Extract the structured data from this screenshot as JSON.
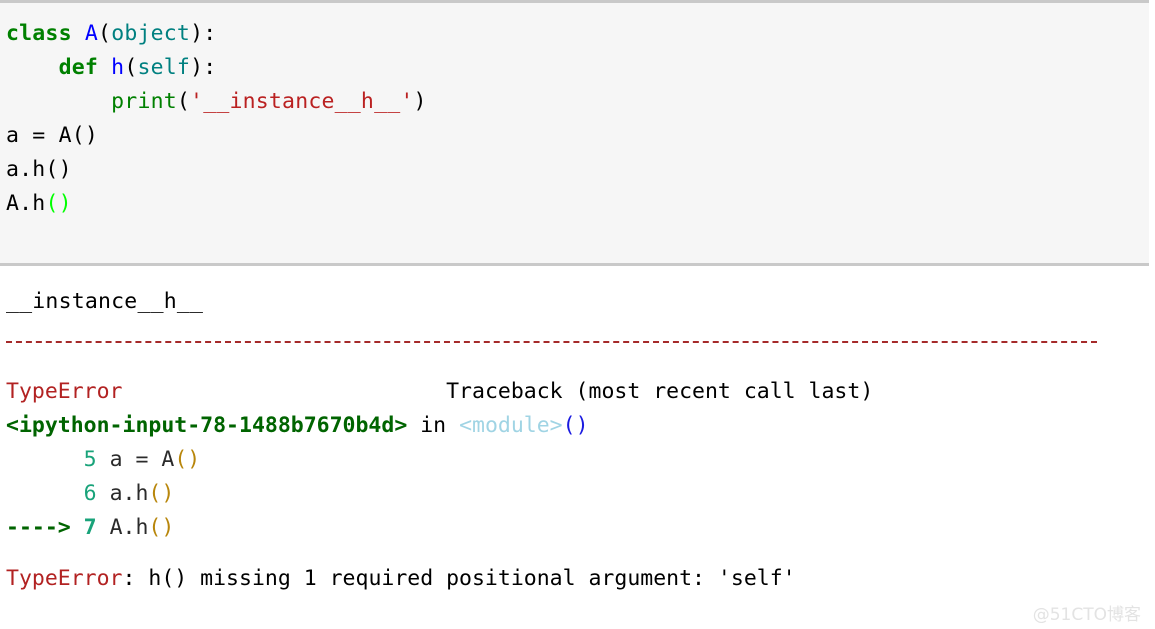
{
  "cell": {
    "background_color": "#f6f6f6",
    "border_color": "#c9c9c9",
    "lines": [
      {
        "id": "l1",
        "kw": "class",
        "sp1": " ",
        "cls": "A",
        "p1": "(",
        "base": "object",
        "p2": "):"
      },
      {
        "id": "l2",
        "indent": "    ",
        "kw": "def",
        "sp1": " ",
        "fn": "h",
        "p1": "(",
        "base": "self",
        "p2": "):"
      },
      {
        "id": "l3",
        "indent": "        ",
        "builtin": "print",
        "p1": "(",
        "str": "'__instance__h__'",
        "p2": ")"
      },
      {
        "id": "l4",
        "text": ""
      },
      {
        "id": "l5",
        "text": "a = A()"
      },
      {
        "id": "l6",
        "text": "a.h()"
      },
      {
        "id": "l7",
        "prefix": "A.h",
        "highlight_paren": "()"
      }
    ]
  },
  "output": {
    "stdout": "__instance__h__",
    "separator": {
      "color": "#a52a2a",
      "style": "dashed"
    },
    "traceback": {
      "error_type": "TypeError",
      "header_right": "Traceback (most recent call last)",
      "location": "<ipython-input-78-1488b7670b4d>",
      "in_keyword": " in ",
      "scope": "<module>",
      "scope_call": "()",
      "frames": [
        {
          "marker": "",
          "lineno": "5",
          "code": "a = A",
          "paren": "()"
        },
        {
          "marker": "",
          "lineno": "6",
          "code": "a.h",
          "paren": "()"
        },
        {
          "marker": "----> ",
          "lineno": "7",
          "code": "A.h",
          "paren": "()"
        }
      ],
      "final_error_name": "TypeError",
      "final_error_message": ": h() missing 1 required positional argument: 'self'"
    }
  },
  "watermark": {
    "text": "@51CTO博客"
  }
}
